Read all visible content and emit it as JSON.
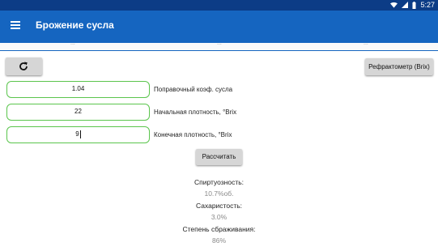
{
  "status_bar": {
    "time": "5:27"
  },
  "app_bar": {
    "title": "Брожение сусла"
  },
  "tabs": [
    "...",
    "...",
    "..."
  ],
  "buttons": {
    "refresh_icon": "refresh-icon",
    "refractometer": "Рефрактометр (Brix)",
    "calculate": "Рассчитать"
  },
  "inputs": [
    {
      "value": "1.04",
      "label": "Поправочный коэф. сусла"
    },
    {
      "value": "22",
      "label": "Начальная плотность, °Brix"
    },
    {
      "value": "9",
      "label": "Конечная плотность, °Brix"
    }
  ],
  "results": {
    "alcohol_label": "Спиртуозность:",
    "alcohol_value": "10.7%об.",
    "sugar_label": "Сахаристость:",
    "sugar_value": "3.0%",
    "attenuation_label": "Степень сбраживания:",
    "attenuation_value": "86%"
  },
  "colors": {
    "status_bar": "#0c3c86",
    "app_bar": "#1565c0",
    "field_border": "#5bc54d"
  }
}
